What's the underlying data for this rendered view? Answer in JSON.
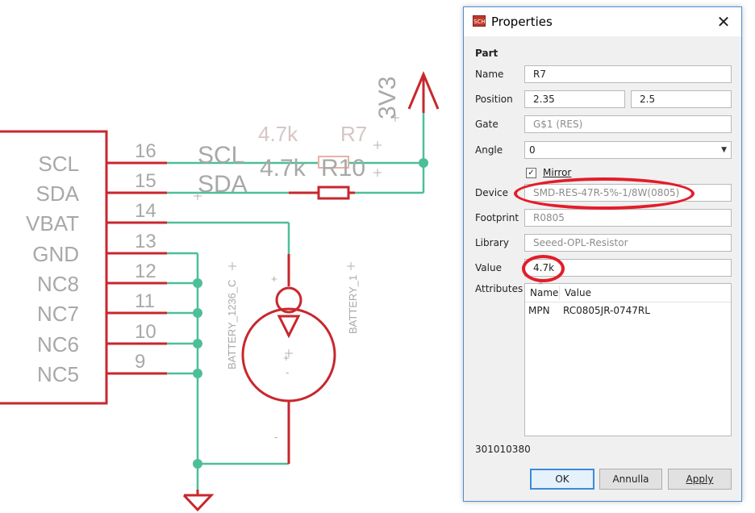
{
  "schematic": {
    "pin_labels": [
      "SCL",
      "SDA",
      "VBAT",
      "GND",
      "NC8",
      "NC7",
      "NC6",
      "NC5"
    ],
    "pin_numbers": [
      "16",
      "15",
      "14",
      "13",
      "12",
      "11",
      "10",
      "9"
    ],
    "net_3v3": "3V3",
    "net_scl": "SCL",
    "net_sda": "SDA",
    "r7_value": "4.7k",
    "r7_name": "R7",
    "r10_value": "4.7k",
    "r10_name": "R10",
    "battery_label_1": "BATTERY_1236_C",
    "battery_label_2": "BATTERY_1",
    "plus_sign": "+",
    "minus_sign": "-",
    "colors": {
      "wire": "#4dbf98",
      "part": "#c8272d",
      "text": "#a8a8a8"
    }
  },
  "dialog": {
    "icon_text": "SCH",
    "title": "Properties",
    "close_icon": "✕",
    "section": "Part",
    "name_label": "Name",
    "name_value": "R7",
    "position_label": "Position",
    "position_x": "2.35",
    "position_y": "2.5",
    "gate_label": "Gate",
    "gate_value": "G$1 (RES)",
    "angle_label": "Angle",
    "angle_value": "0",
    "mirror_label": "Mirror",
    "mirror_checked": "✓",
    "device_label": "Device",
    "device_value": "SMD-RES-47R-5%-1/8W(0805)",
    "footprint_label": "Footprint",
    "footprint_value": "R0805",
    "library_label": "Library",
    "library_value": "Seeed-OPL-Resistor",
    "value_label": "Value",
    "value_value": "4.7k",
    "attributes_label": "Attributes",
    "attr_col_name": "Name",
    "attr_col_value": "Value",
    "attr_row_name": "MPN",
    "attr_row_value": "RC0805JR-0747RL",
    "footer_id": "301010380",
    "ok_label": "OK",
    "cancel_label": "Annulla",
    "apply_label": "Apply"
  }
}
